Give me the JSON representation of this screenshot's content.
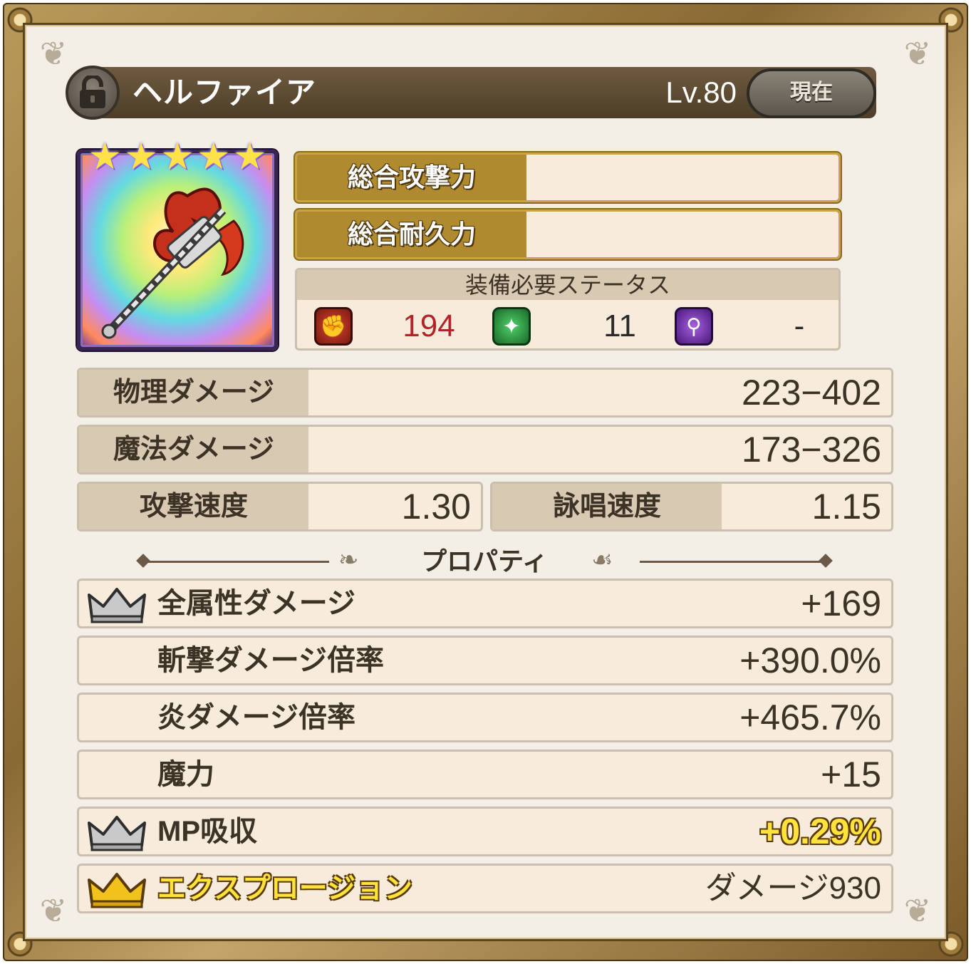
{
  "header": {
    "item_name": "ヘルファイア",
    "level": "Lv.80",
    "current_button": "現在",
    "lock_icon": "lock-open-icon"
  },
  "weapon": {
    "icon": "flame-axe-icon",
    "rarity_stars": 5
  },
  "summary": {
    "attack_label": "総合攻撃力",
    "attack_value": "",
    "durability_label": "総合耐久力",
    "durability_value": ""
  },
  "requirements": {
    "title": "装備必要ステータス",
    "items": [
      {
        "icon": "strength-fist-icon",
        "value": "194",
        "color": "#b3232a"
      },
      {
        "icon": "dexterity-star-icon",
        "value": "11",
        "color": "#2a2a2a"
      },
      {
        "icon": "magic-wand-icon",
        "value": "-",
        "color": "#2a2a2a"
      }
    ]
  },
  "damage": {
    "physical_label": "物理ダメージ",
    "physical_value": "223−402",
    "magic_label": "魔法ダメージ",
    "magic_value": "173−326",
    "attack_speed_label": "攻撃速度",
    "attack_speed_value": "1.30",
    "cast_speed_label": "詠唱速度",
    "cast_speed_value": "1.15"
  },
  "properties": {
    "title": "プロパティ",
    "items": [
      {
        "label": "全属性ダメージ",
        "value": "+169",
        "crown": "silver"
      },
      {
        "label": "斬撃ダメージ倍率",
        "value": "+390.0%",
        "crown": ""
      },
      {
        "label": "炎ダメージ倍率",
        "value": "+465.7%",
        "crown": ""
      },
      {
        "label": "魔力",
        "value": "+15",
        "crown": ""
      },
      {
        "label": "MP吸収",
        "value": "+0.29%",
        "crown": "silver"
      },
      {
        "label": "エクスプロージョン",
        "value": "ダメージ930",
        "crown": "gold"
      }
    ]
  },
  "colors": {
    "gold_bar": "#b08a2e",
    "panel_bg": "#f3efe6",
    "label_bg": "#d7c9b2",
    "value_bg": "#f7ecdc",
    "crown_gold": "#f2c21c",
    "crown_silver": "#b9b9b9"
  }
}
